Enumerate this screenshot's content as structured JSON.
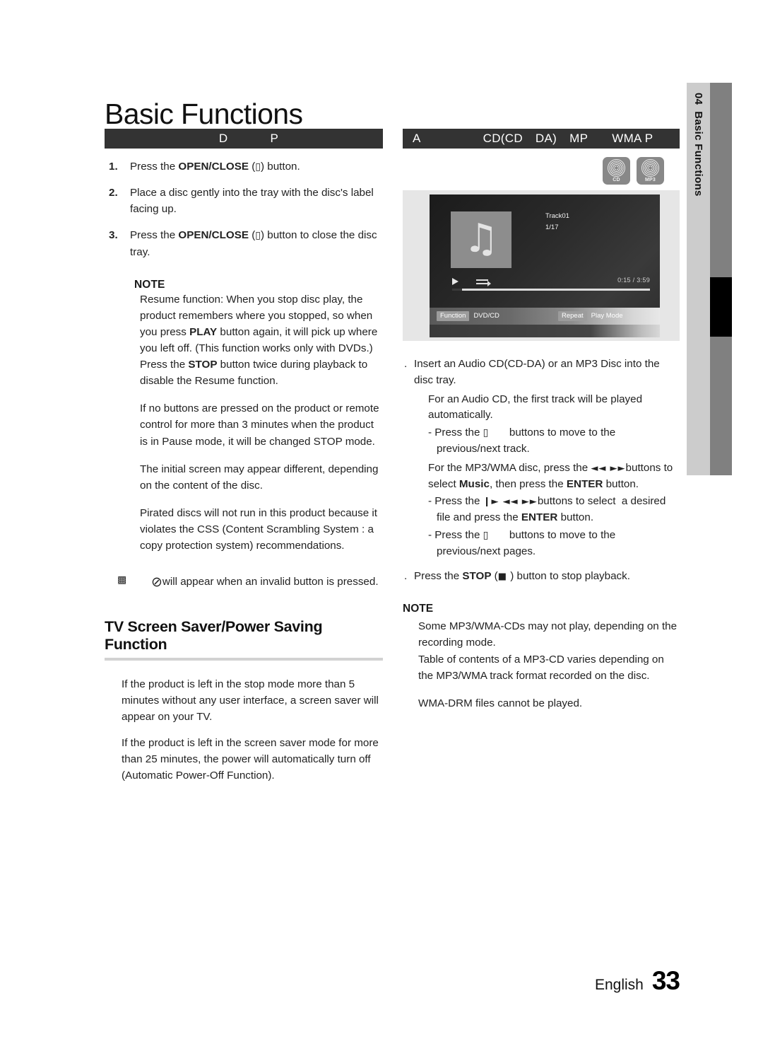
{
  "page": {
    "title": "Basic Functions",
    "footer_language": "English",
    "footer_page_number": "33"
  },
  "side_tab": {
    "chapter_number": "04",
    "chapter_name": "Basic Functions"
  },
  "left_column": {
    "section_bar": {
      "seg1": "D",
      "seg2": "P"
    },
    "steps": [
      {
        "num": "1.",
        "html": "Press the <b>OPEN/CLOSE</b> (<span class=\"box-gl\">▯</span>) button."
      },
      {
        "num": "2.",
        "html": "Place a disc gently into the tray with the disc's label facing up."
      },
      {
        "num": "3.",
        "html": "Press the <b>OPEN/CLOSE</b> (<span class=\"box-gl\">▯</span>) button to close the disc tray."
      }
    ],
    "note_label": "NOTE",
    "note_paragraphs": [
      "Resume function: When you stop disc play, the product remembers where you stopped, so when you press <b>PLAY</b> button again, it will pick up where you left off. (This function works only with DVDs.)",
      "Press the <b>STOP</b> button twice during playback to disable the Resume function.",
      "If no buttons are pressed on the product or remote control for more than 3 minutes when the product is in Pause mode, it will be changed STOP mode.",
      "The initial screen may appear different, depending on the content of the disc.",
      "Pirated discs will not run in this product because it violates the CSS (Content Scrambling System : a copy protection system) recommendations."
    ],
    "invalid_button_note": {
      "marker": "▩",
      "symbol": "⊘",
      "text": "will appear when an invalid button is pressed."
    },
    "subsection": {
      "heading": "TV Screen Saver/Power Saving Function",
      "paragraphs": [
        "If the product is left in the stop mode more than 5 minutes without any user interface, a screen saver will appear on your TV.",
        "If the product is left in the screen saver mode for more than 25 minutes, the power will automatically turn off (Automatic Power-Off Function)."
      ]
    }
  },
  "right_column": {
    "section_bar": {
      "seg1": "A",
      "seg2": "CD(CD",
      "seg3": "DA)",
      "seg4": "MP",
      "seg5": "WMA P"
    },
    "badges": [
      {
        "name": "CD",
        "label": "CD"
      },
      {
        "name": "MP3",
        "label": "MP3"
      }
    ],
    "tv_screen": {
      "track_title": "Track01",
      "track_index": "1/17",
      "time_current": "0:15",
      "time_separator": "/",
      "time_total": "3:59",
      "footer_buttons": [
        "Function",
        "DVD/CD",
        "Repeat",
        "Play Mode"
      ]
    },
    "items": [
      {
        "bullet": ".",
        "html": "Insert an Audio CD(CD-DA) or an MP3 Disc into the disc tray."
      }
    ],
    "sub_lines": [
      {
        "type": "plain",
        "html": "For an Audio CD, the first track will be played automatically."
      },
      {
        "type": "dash",
        "html": "- Press the <span class=\"box-gl\">▯</span>&nbsp;&nbsp;&nbsp;&nbsp;&nbsp;&nbsp; buttons to move to the previous/next track."
      },
      {
        "type": "plain",
        "html": "For the MP3/WMA disc, press the <span class=\"gl\">◄◄ ►►</span>buttons to select <b>Music</b>, then press the <b>ENTER</b> button."
      },
      {
        "type": "dash",
        "html": "- Press the <span class=\"gl\">❙► ◄◄ ►►</span>buttons to select&nbsp; a desired file and press the <b>ENTER</b> button."
      },
      {
        "type": "dash",
        "html": "- Press the <span class=\"box-gl\">▯</span>&nbsp;&nbsp;&nbsp;&nbsp;&nbsp;&nbsp; buttons to move to the previous/next pages."
      }
    ],
    "stop_item": {
      "bullet": ".",
      "html": "Press the <b>STOP</b> (<span class=\"gl\">■</span> ) button to stop playback."
    },
    "note_label": "NOTE",
    "note_paragraphs": [
      "Some MP3/WMA-CDs may not play, depending on the recording mode.",
      "Table of contents of a MP3-CD varies depending on the MP3/WMA track format recorded on the disc.",
      "WMA-DRM files cannot be played."
    ]
  }
}
